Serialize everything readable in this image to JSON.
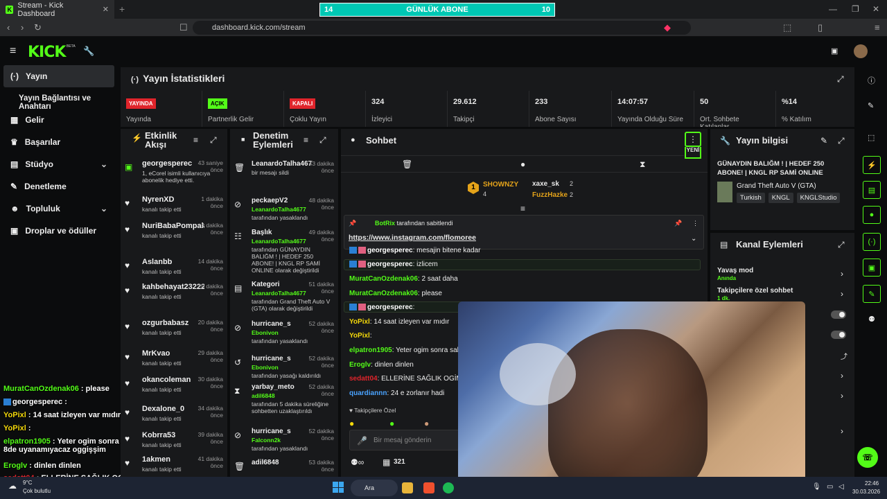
{
  "browser": {
    "tab_title": "Stream - Kick Dashboard",
    "url": "dashboard.kick.com/stream",
    "banner": {
      "left": "14",
      "title": "GÜNLÜK ABONE",
      "right": "10"
    }
  },
  "brand": {
    "logo": "KICK",
    "beta": "BETA",
    "accent": "#53fc18"
  },
  "sidebar": {
    "items": [
      {
        "label": "Yayın",
        "icon": "broadcast-icon"
      },
      {
        "label": "Yayın Bağlantısı ve Anahtarı"
      },
      {
        "label": "Gelir",
        "icon": "chart-icon"
      },
      {
        "label": "Başarılar",
        "icon": "trophy-icon"
      },
      {
        "label": "Stüdyo",
        "icon": "studio-icon"
      },
      {
        "label": "Denetleme",
        "icon": "wrench-icon"
      },
      {
        "label": "Topluluk",
        "icon": "people-icon"
      },
      {
        "label": "Droplar ve ödüller",
        "icon": "gift-icon"
      }
    ]
  },
  "stats": {
    "title": "Yayın İstatistikleri",
    "cells": [
      {
        "badge": "YAYINDA",
        "badge_color": "#e0242b",
        "label": "Yayında"
      },
      {
        "badge": "AÇIK",
        "badge_color": "#53fc18",
        "label": "Partnerlik Gelir"
      },
      {
        "badge": "KAPALI",
        "badge_color": "#e0242b",
        "label": "Çoklu Yayın"
      },
      {
        "value": "324",
        "label": "İzleyici"
      },
      {
        "value": "29.612",
        "label": "Takipçi"
      },
      {
        "value": "233",
        "label": "Abone Sayısı"
      },
      {
        "value": "14:07:57",
        "label": "Yayında Olduğu Süre"
      },
      {
        "value": "50",
        "label": "Ort. Sohbete Katılanlar"
      },
      {
        "value": "%14",
        "label": "% Katılım"
      }
    ]
  },
  "activity": {
    "title": "Etkinlik Akışı",
    "items": [
      {
        "user": "georgesperec",
        "time": "43 saniye önce",
        "sub": "1, eCorel isimli kullanıcıya abonelik hediye etti.",
        "icon": "gift-icon"
      },
      {
        "user": "NyrenXD",
        "time": "1 dakika önce",
        "sub": "kanalı takip etti",
        "icon": "heart-icon"
      },
      {
        "user": "NuriBabaPompalarr",
        "time": "4 dakika önce",
        "sub": "kanalı takip etti",
        "icon": "heart-icon"
      },
      {
        "user": "Aslanbb",
        "time": "14 dakika önce",
        "sub": "kanalı takip etti",
        "icon": "heart-icon"
      },
      {
        "user": "kahbehayat23222f",
        "time": "20 dakika önce",
        "sub": "kanalı takip etti",
        "icon": "heart-icon"
      },
      {
        "user": "ozgurbabasz",
        "time": "20 dakika önce",
        "sub": "kanalı takip etti",
        "icon": "heart-icon"
      },
      {
        "user": "MrKvao",
        "time": "29 dakika önce",
        "sub": "kanalı takip etti",
        "icon": "heart-icon"
      },
      {
        "user": "okancoleman",
        "time": "30 dakika önce",
        "sub": "kanalı takip etti",
        "icon": "heart-icon"
      },
      {
        "user": "Dexalone_0",
        "time": "34 dakika önce",
        "sub": "kanalı takip etti",
        "icon": "heart-icon"
      },
      {
        "user": "Kobrra53",
        "time": "39 dakika önce",
        "sub": "kanalı takip etti",
        "icon": "heart-icon"
      },
      {
        "user": "1akmen",
        "time": "41 dakika önce",
        "sub": "kanalı takip etti",
        "icon": "heart-icon"
      }
    ]
  },
  "moderation": {
    "title": "Denetim Eylemleri",
    "items": [
      {
        "user": "LeanardoTalha4677",
        "time": "43 dakika önce",
        "lines": [
          "bir mesajı sildi"
        ],
        "icon": "trash-icon"
      },
      {
        "user": "peckaepV2",
        "time": "48 dakika önce",
        "lines": [
          "LeanardoTalha4677",
          "tarafından yasaklandı"
        ],
        "icon": "ban-icon"
      },
      {
        "user": "Başlık",
        "time": "49 dakika önce",
        "lines": [
          "LeanardoTalha4677",
          "tarafından GÜNAYDIN BALIĞM ! | HEDEF 250 ABONE! | KNGL RP SAMİ ONLINE olarak değiştirildi"
        ],
        "icon": "title-icon"
      },
      {
        "user": "Kategori",
        "time": "51 dakika önce",
        "lines": [
          "LeanardoTalha4677",
          "tarafından Grand Theft Auto V (GTA) olarak değiştirildi"
        ],
        "icon": "category-icon"
      },
      {
        "user": "hurricane_s",
        "time": "52 dakika önce",
        "lines": [
          "Ebonivon",
          "tarafından yasaklandı"
        ],
        "icon": "ban-icon"
      },
      {
        "user": "hurricane_s",
        "time": "52 dakika önce",
        "lines": [
          "Ebonivon",
          "tarafından yasağı kaldırıldı"
        ],
        "icon": "undo-icon"
      },
      {
        "user": "yarbay_meto",
        "time": "52 dakika önce",
        "lines": [
          "adil6848",
          "tarafından 5 dakika süreliğine sohbetten uzaklaştırıldı"
        ],
        "icon": "hourglass-icon"
      },
      {
        "user": "hurricane_s",
        "time": "52 dakika önce",
        "lines": [
          "Falconn2k",
          "tarafından yasaklandı"
        ],
        "icon": "ban-icon"
      },
      {
        "user": "adil6848",
        "time": "53 dakika önce",
        "lines": [
          ""
        ],
        "icon": "trash-icon"
      }
    ]
  },
  "chat": {
    "title": "Sohbet",
    "new_label": "YENİ",
    "leaderboard": [
      {
        "name": "SHOWNZY",
        "count": "4"
      },
      {
        "name": "xaxe_sk",
        "count": "2"
      },
      {
        "name": "FuzzHazke",
        "count": "2"
      }
    ],
    "pinned_by": "BotRix",
    "pinned_text": "tarafından sabitlendi",
    "pinned_link": "https://www.instagram.com/flomoree",
    "messages": [
      {
        "user": "georgesperec",
        "text": ": mesajin bitene kadar"
      },
      {
        "user": "georgesperec",
        "text": ": izlicem"
      },
      {
        "user": "MuratCanOzdenak06",
        "text": ": 2 saat daha"
      },
      {
        "user": "MuratCanOzdenak06",
        "text": ": please"
      },
      {
        "user": "georgesperec",
        "text": ":"
      },
      {
        "user": "YoPixl",
        "text": ": 14 saat izleyen var mıdır"
      },
      {
        "user": "YoPixl",
        "text": ":"
      },
      {
        "user": "elpatron1905",
        "text": ": Yeter ogim sonra sabah"
      },
      {
        "user": "Eroglv",
        "text": ": dinlen dinlen"
      },
      {
        "user": "sedatt04",
        "text": ": ELLERİNE SAĞLIK OGİMMM"
      },
      {
        "user": "quardiannn",
        "text": ": 24 e zorlanır hadi"
      }
    ],
    "followers_only": "Takipçilere Özel",
    "input_placeholder": "Bir mesaj gönderin",
    "viewer_count": "321"
  },
  "stream_info": {
    "title": "Yayın bilgisi",
    "stream_title": "GÜNAYDIN BALIĞM ! | HEDEF 250 ABONE! | KNGL RP SAMİ ONLINE",
    "category": "Grand Theft Auto V (GTA)",
    "tags": [
      "Turkish",
      "KNGL",
      "KNGLStudio"
    ]
  },
  "channel_actions": {
    "title": "Kanal Eylemleri",
    "items": [
      {
        "label": "Yavaş mod",
        "sub": "Anında"
      },
      {
        "label": "Takipçilere özel sohbet",
        "sub": "1 dk."
      }
    ]
  },
  "overlay_chat": [
    {
      "user": "MuratCanOzdenak06",
      "text": " : please",
      "color": "#53fc18"
    },
    {
      "user": "georgesperec",
      "text": " :",
      "color": "#ffffff"
    },
    {
      "user": "YoPixl",
      "text": " : 14 saat izleyen var mıdır",
      "color": "#f5d90a"
    },
    {
      "user": "YoPixl",
      "text": " :",
      "color": "#f5d90a"
    },
    {
      "user": "elpatron1905",
      "text": " : Yeter ogim sonra sabah 8de uyanamıyacaz oggişşim",
      "color": "#53fc18"
    },
    {
      "user": "Eroglv",
      "text": " : dinlen dinlen",
      "color": "#53fc18"
    },
    {
      "user": "sedatt04",
      "text": " : ELLERİNE SAĞLIK OGİMMMM",
      "color": "#e0242b"
    }
  ],
  "taskbar": {
    "weather_temp": "9°C",
    "weather_text": "Çok bulutlu",
    "search": "Ara",
    "time": "22:46",
    "date": "30.03.2026"
  }
}
